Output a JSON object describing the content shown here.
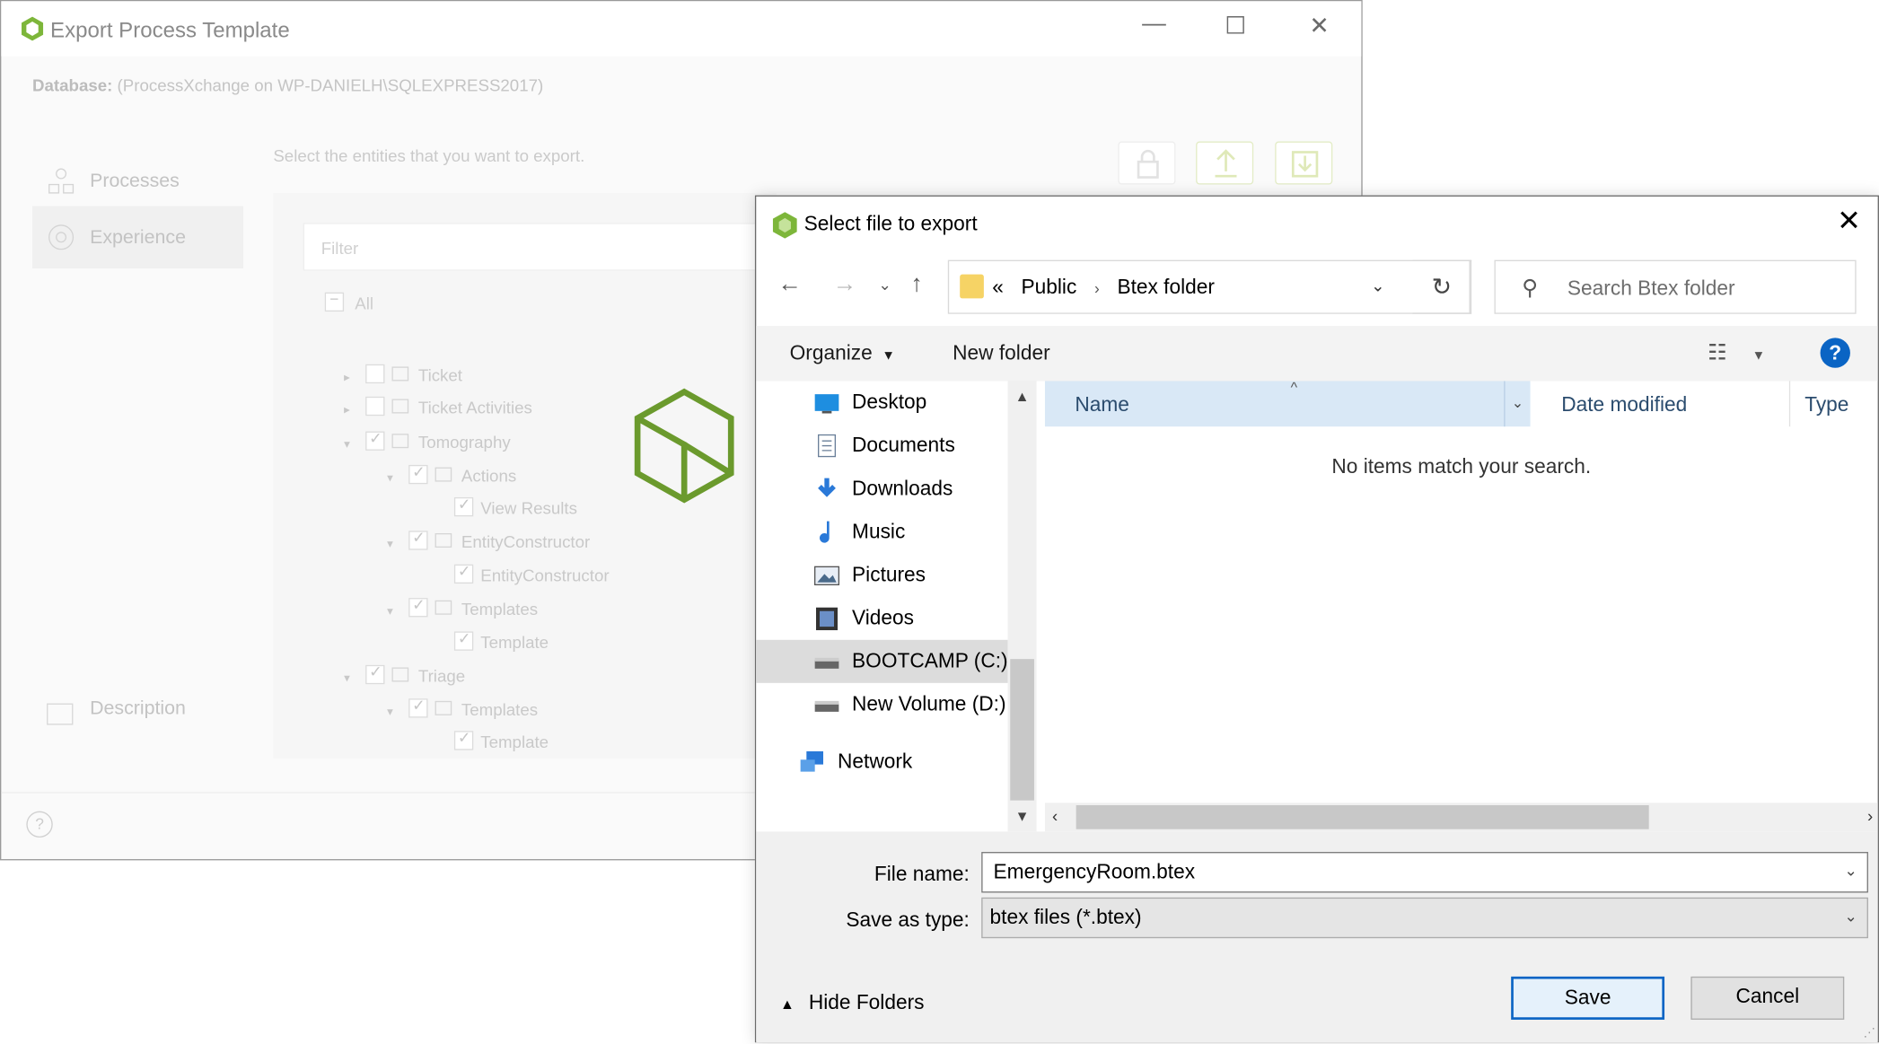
{
  "bg": {
    "title": "Export Process Template",
    "db_label": "Database:",
    "db_value": "(ProcessXchange on WP-DANIELH\\SQLEXPRESS2017)",
    "nav": [
      "Processes",
      "Experience",
      "Description"
    ],
    "hint": "Select the entities that you want to export.",
    "filter_placeholder": "Filter",
    "all_label": "All",
    "tree": [
      {
        "label": "Ticket",
        "level": 0,
        "arrow": "▸",
        "checked": false,
        "icon": "entity"
      },
      {
        "label": "Ticket Activities",
        "level": 0,
        "arrow": "▸",
        "checked": false,
        "icon": "entity"
      },
      {
        "label": "Tomography",
        "level": 0,
        "arrow": "▾",
        "checked": true,
        "icon": "entity"
      },
      {
        "label": "Actions",
        "level": 1,
        "arrow": "▾",
        "checked": true,
        "icon": "table"
      },
      {
        "label": "View Results",
        "level": 2,
        "arrow": "",
        "checked": true,
        "icon": ""
      },
      {
        "label": "EntityConstructor",
        "level": 1,
        "arrow": "▾",
        "checked": true,
        "icon": "table"
      },
      {
        "label": "EntityConstructor",
        "level": 2,
        "arrow": "",
        "checked": true,
        "icon": ""
      },
      {
        "label": "Templates",
        "level": 1,
        "arrow": "▾",
        "checked": true,
        "icon": "table"
      },
      {
        "label": "Template",
        "level": 2,
        "arrow": "",
        "checked": true,
        "icon": ""
      },
      {
        "label": "Triage",
        "level": 0,
        "arrow": "▾",
        "checked": true,
        "icon": "entity"
      },
      {
        "label": "Templates",
        "level": 1,
        "arrow": "▾",
        "checked": true,
        "icon": "table"
      },
      {
        "label": "Template",
        "level": 2,
        "arrow": "",
        "checked": true,
        "icon": ""
      }
    ]
  },
  "dialog": {
    "title": "Select file to export",
    "close_glyph": "✕",
    "address": {
      "prefix": "«",
      "crumbs": [
        "Public",
        "Btex folder"
      ]
    },
    "search_placeholder": "Search Btex folder",
    "toolbar": {
      "organize": "Organize",
      "new_folder": "New folder",
      "help": "?"
    },
    "nav_items": [
      {
        "label": "Desktop",
        "icon": "desktop-icon",
        "selected": false
      },
      {
        "label": "Documents",
        "icon": "documents-icon",
        "selected": false
      },
      {
        "label": "Downloads",
        "icon": "downloads-icon",
        "selected": false
      },
      {
        "label": "Music",
        "icon": "music-icon",
        "selected": false
      },
      {
        "label": "Pictures",
        "icon": "pictures-icon",
        "selected": false
      },
      {
        "label": "Videos",
        "icon": "videos-icon",
        "selected": false
      },
      {
        "label": "BOOTCAMP (C:)",
        "icon": "drive-icon",
        "selected": true
      },
      {
        "label": "New Volume (D:)",
        "icon": "drive-icon",
        "selected": false
      },
      {
        "label": "Network",
        "icon": "network-icon",
        "selected": false
      }
    ],
    "columns": {
      "name": "Name",
      "date": "Date modified",
      "type": "Type"
    },
    "empty_message": "No items match your search.",
    "file_name_label": "File name:",
    "file_name_value": "EmergencyRoom.btex",
    "save_type_label": "Save as type:",
    "save_type_value": "btex files (*.btex)",
    "hide_folders": "Hide Folders",
    "save_label": "Save",
    "cancel_label": "Cancel"
  },
  "colors": {
    "accent": "#0a64c4",
    "brand_green": "#6b9a2d",
    "selection": "#d9e8f6"
  }
}
